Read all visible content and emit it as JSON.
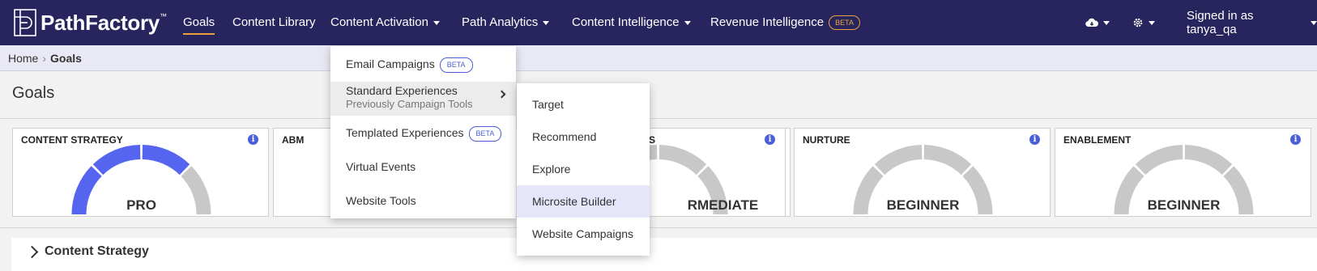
{
  "brand": {
    "name": "PathFactory",
    "tm": "™"
  },
  "nav": {
    "items": [
      {
        "label": "Goals",
        "active": true,
        "caret": false
      },
      {
        "label": "Content Library",
        "active": false,
        "caret": false
      },
      {
        "label": "Content Activation",
        "active": false,
        "caret": true
      },
      {
        "label": "Path Analytics",
        "active": false,
        "caret": true
      },
      {
        "label": "Content Intelligence",
        "active": false,
        "caret": true
      },
      {
        "label": "Revenue Intelligence",
        "active": false,
        "caret": false,
        "badge": "BETA"
      }
    ],
    "user": "Signed in as tanya_qa",
    "icons": {
      "cloud": "cloud-download-icon",
      "settings": "gear-icon"
    }
  },
  "breadcrumb": {
    "home": "Home",
    "separator": "›",
    "current": "Goals"
  },
  "page": {
    "title": "Goals"
  },
  "cards": [
    {
      "title": "CONTENT STRATEGY",
      "level": "PRO",
      "filled_segments": 3,
      "total_segments": 4
    },
    {
      "title": "ABM",
      "level": "",
      "filled_segments": 0,
      "total_segments": 4
    },
    {
      "title": "",
      "level": "",
      "filled_segments": 0,
      "total_segments": 4
    },
    {
      "title": "S",
      "level": "RMEDIATE",
      "filled_segments": 0,
      "total_segments": 4
    },
    {
      "title": "NURTURE",
      "level": "BEGINNER",
      "filled_segments": 0,
      "total_segments": 4
    },
    {
      "title": "ENABLEMENT",
      "level": "BEGINNER",
      "filled_segments": 0,
      "total_segments": 4
    }
  ],
  "colors": {
    "gauge_fill": "#5565f0",
    "gauge_empty": "#c8c8c8",
    "nav_bg": "#27245e",
    "accent": "#e8a33d"
  },
  "section": {
    "label": "Content Strategy"
  },
  "menu": {
    "items": [
      {
        "label": "Email Campaigns",
        "badge": "BETA"
      },
      {
        "label": "Standard Experiences",
        "sub": "Previously Campaign Tools",
        "has_submenu": true
      },
      {
        "label": "Templated Experiences",
        "badge": "BETA"
      },
      {
        "label": "Virtual Events"
      },
      {
        "label": "Website Tools"
      }
    ]
  },
  "submenu": {
    "items": [
      {
        "label": "Target"
      },
      {
        "label": "Recommend"
      },
      {
        "label": "Explore"
      },
      {
        "label": "Microsite Builder"
      },
      {
        "label": "Website Campaigns"
      }
    ]
  }
}
